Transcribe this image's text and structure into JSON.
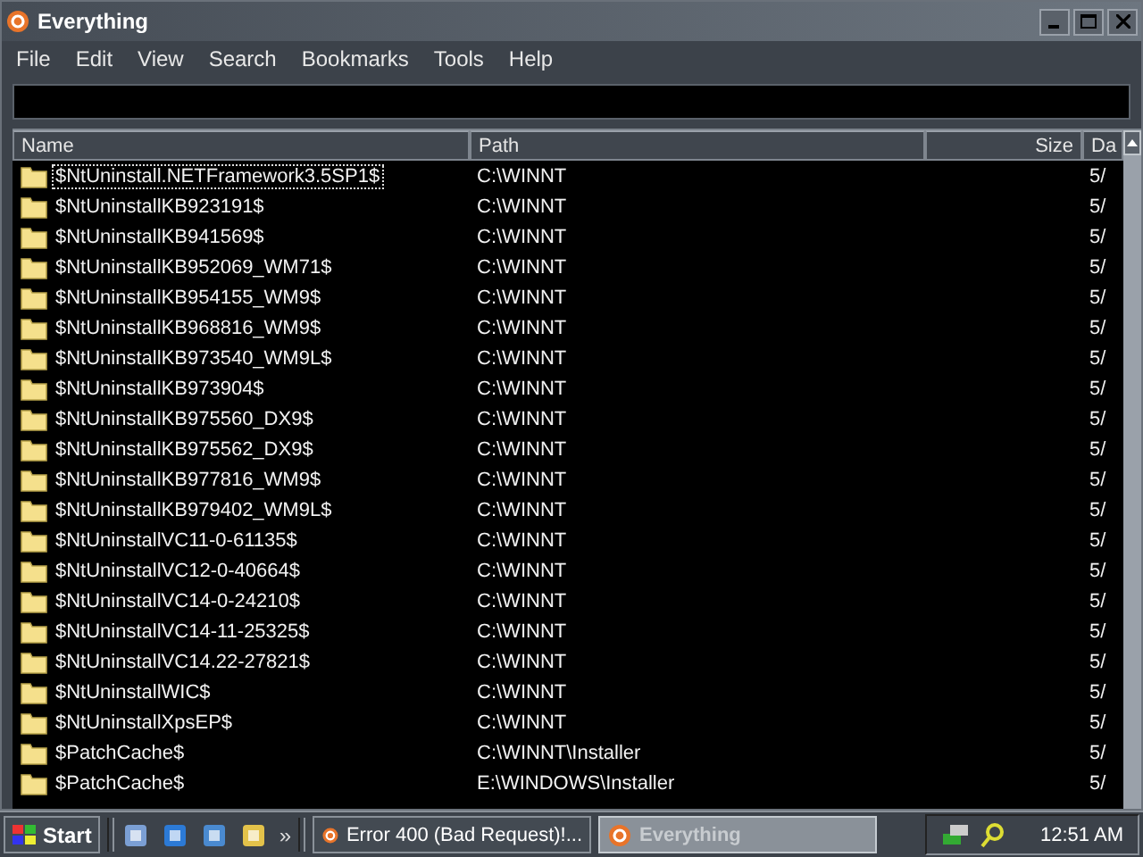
{
  "window": {
    "title": "Everything"
  },
  "menu": [
    "File",
    "Edit",
    "View",
    "Search",
    "Bookmarks",
    "Tools",
    "Help"
  ],
  "table": {
    "columns": [
      "Name",
      "Path",
      "Size",
      "Da"
    ],
    "rows": [
      {
        "name": "$NtUninstall.NETFramework3.5SP1$",
        "path": "C:\\WINNT",
        "date": "5/",
        "selected": true
      },
      {
        "name": "$NtUninstallKB923191$",
        "path": "C:\\WINNT",
        "date": "5/",
        "selected": false
      },
      {
        "name": "$NtUninstallKB941569$",
        "path": "C:\\WINNT",
        "date": "5/",
        "selected": false
      },
      {
        "name": "$NtUninstallKB952069_WM71$",
        "path": "C:\\WINNT",
        "date": "5/",
        "selected": false
      },
      {
        "name": "$NtUninstallKB954155_WM9$",
        "path": "C:\\WINNT",
        "date": "5/",
        "selected": false
      },
      {
        "name": "$NtUninstallKB968816_WM9$",
        "path": "C:\\WINNT",
        "date": "5/",
        "selected": false
      },
      {
        "name": "$NtUninstallKB973540_WM9L$",
        "path": "C:\\WINNT",
        "date": "5/",
        "selected": false
      },
      {
        "name": "$NtUninstallKB973904$",
        "path": "C:\\WINNT",
        "date": "5/",
        "selected": false
      },
      {
        "name": "$NtUninstallKB975560_DX9$",
        "path": "C:\\WINNT",
        "date": "5/",
        "selected": false
      },
      {
        "name": "$NtUninstallKB975562_DX9$",
        "path": "C:\\WINNT",
        "date": "5/",
        "selected": false
      },
      {
        "name": "$NtUninstallKB977816_WM9$",
        "path": "C:\\WINNT",
        "date": "5/",
        "selected": false
      },
      {
        "name": "$NtUninstallKB979402_WM9L$",
        "path": "C:\\WINNT",
        "date": "5/",
        "selected": false
      },
      {
        "name": "$NtUninstallVC11-0-61135$",
        "path": "C:\\WINNT",
        "date": "5/",
        "selected": false
      },
      {
        "name": "$NtUninstallVC12-0-40664$",
        "path": "C:\\WINNT",
        "date": "5/",
        "selected": false
      },
      {
        "name": "$NtUninstallVC14-0-24210$",
        "path": "C:\\WINNT",
        "date": "5/",
        "selected": false
      },
      {
        "name": "$NtUninstallVC14-11-25325$",
        "path": "C:\\WINNT",
        "date": "5/",
        "selected": false
      },
      {
        "name": "$NtUninstallVC14.22-27821$",
        "path": "C:\\WINNT",
        "date": "5/",
        "selected": false
      },
      {
        "name": "$NtUninstallWIC$",
        "path": "C:\\WINNT",
        "date": "5/",
        "selected": false
      },
      {
        "name": "$NtUninstallXpsEP$",
        "path": "C:\\WINNT",
        "date": "5/",
        "selected": false
      },
      {
        "name": "$PatchCache$",
        "path": "C:\\WINNT\\Installer",
        "date": "5/",
        "selected": false
      },
      {
        "name": "$PatchCache$",
        "path": "E:\\WINDOWS\\Installer",
        "date": "5/",
        "selected": false
      }
    ]
  },
  "taskbar": {
    "start": "Start",
    "more": "»",
    "tasks": [
      {
        "label": "Error 400 (Bad Request)!...",
        "selected": false
      },
      {
        "label": "Everything",
        "selected": true
      }
    ],
    "clock": "12:51 AM"
  }
}
